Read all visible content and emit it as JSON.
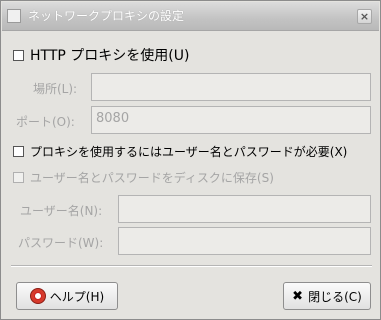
{
  "window": {
    "title": "ネットワークプロキシの設定",
    "close_glyph": "×"
  },
  "http_proxy": {
    "label": "HTTP プロキシを使用(U)",
    "checked": false
  },
  "location": {
    "label": "場所(L):",
    "value": ""
  },
  "port": {
    "label": "ポート(O):",
    "value": "8080"
  },
  "auth_required": {
    "label": "プロキシを使用するにはユーザー名とパスワードが必要(X)",
    "checked": false
  },
  "save_to_disk": {
    "label": "ユーザー名とパスワードをディスクに保存(S)",
    "checked": false
  },
  "username": {
    "label": "ユーザー名(N):",
    "value": ""
  },
  "password": {
    "label": "パスワード(W):",
    "value": ""
  },
  "buttons": {
    "help_label": "ヘルプ(H)",
    "help_icon": "lifebuoy-icon",
    "close_label": "閉じる(C)",
    "close_icon": "close-icon"
  },
  "colors": {
    "dialog_bg": "#e4e3df",
    "disabled_text": "#a5a5a5",
    "help_icon_red": "#d63a2c"
  }
}
